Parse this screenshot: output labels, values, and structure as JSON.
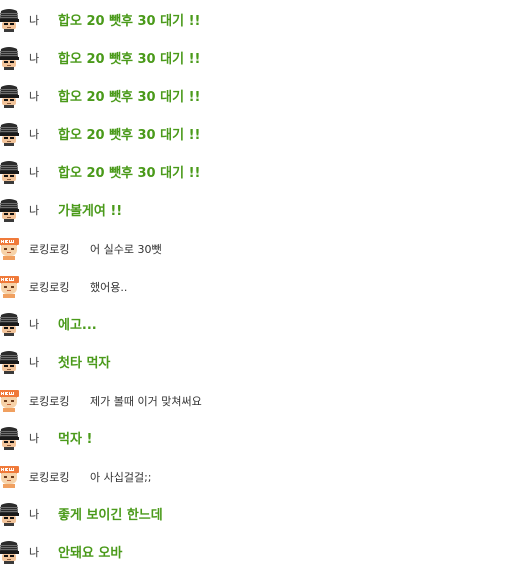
{
  "messages": [
    {
      "sender": "나",
      "text": "합오 20 뺏후 30 대기 !!",
      "avatar_icon": "helmet-soldier-icon"
    },
    {
      "sender": "나",
      "text": "합오 20 뺏후 30 대기 !!",
      "avatar_icon": "helmet-soldier-icon"
    },
    {
      "sender": "나",
      "text": "합오 20 뺏후 30 대기 !!",
      "avatar_icon": "helmet-soldier-icon"
    },
    {
      "sender": "나",
      "text": "합오 20 뺏후 30 대기 !!",
      "avatar_icon": "helmet-soldier-icon"
    },
    {
      "sender": "나",
      "text": "합오 20 뺏후 30 대기 !!",
      "avatar_icon": "helmet-soldier-icon"
    },
    {
      "sender": "나",
      "text": "가볼게여 !!",
      "avatar_icon": "helmet-soldier-icon"
    },
    {
      "sender": "로킹로킹",
      "text": "어 실수로 30뺏",
      "avatar_icon": "new-user-icon"
    },
    {
      "sender": "로킹로킹",
      "text": "했어용..",
      "avatar_icon": "new-user-icon"
    },
    {
      "sender": "나",
      "text": "에고...",
      "avatar_icon": "helmet-soldier-icon"
    },
    {
      "sender": "나",
      "text": "첫타 먹자",
      "avatar_icon": "helmet-soldier-icon"
    },
    {
      "sender": "로킹로킹",
      "text": "제가 볼때 이거 맞쳐써요",
      "avatar_icon": "new-user-icon"
    },
    {
      "sender": "나",
      "text": "먹자 !",
      "avatar_icon": "helmet-soldier-icon"
    },
    {
      "sender": "로킹로킹",
      "text": "아 사십걸걸;;",
      "avatar_icon": "new-user-icon"
    },
    {
      "sender": "나",
      "text": "좋게 보이긴 한느데",
      "avatar_icon": "helmet-soldier-icon"
    },
    {
      "sender": "나",
      "text": "안돼요 오바",
      "avatar_icon": "helmet-soldier-icon"
    }
  ],
  "colors": {
    "my_message": "#4a9a1a",
    "other_message": "#333333",
    "name": "#333333",
    "new_badge": "#f07a3a"
  }
}
